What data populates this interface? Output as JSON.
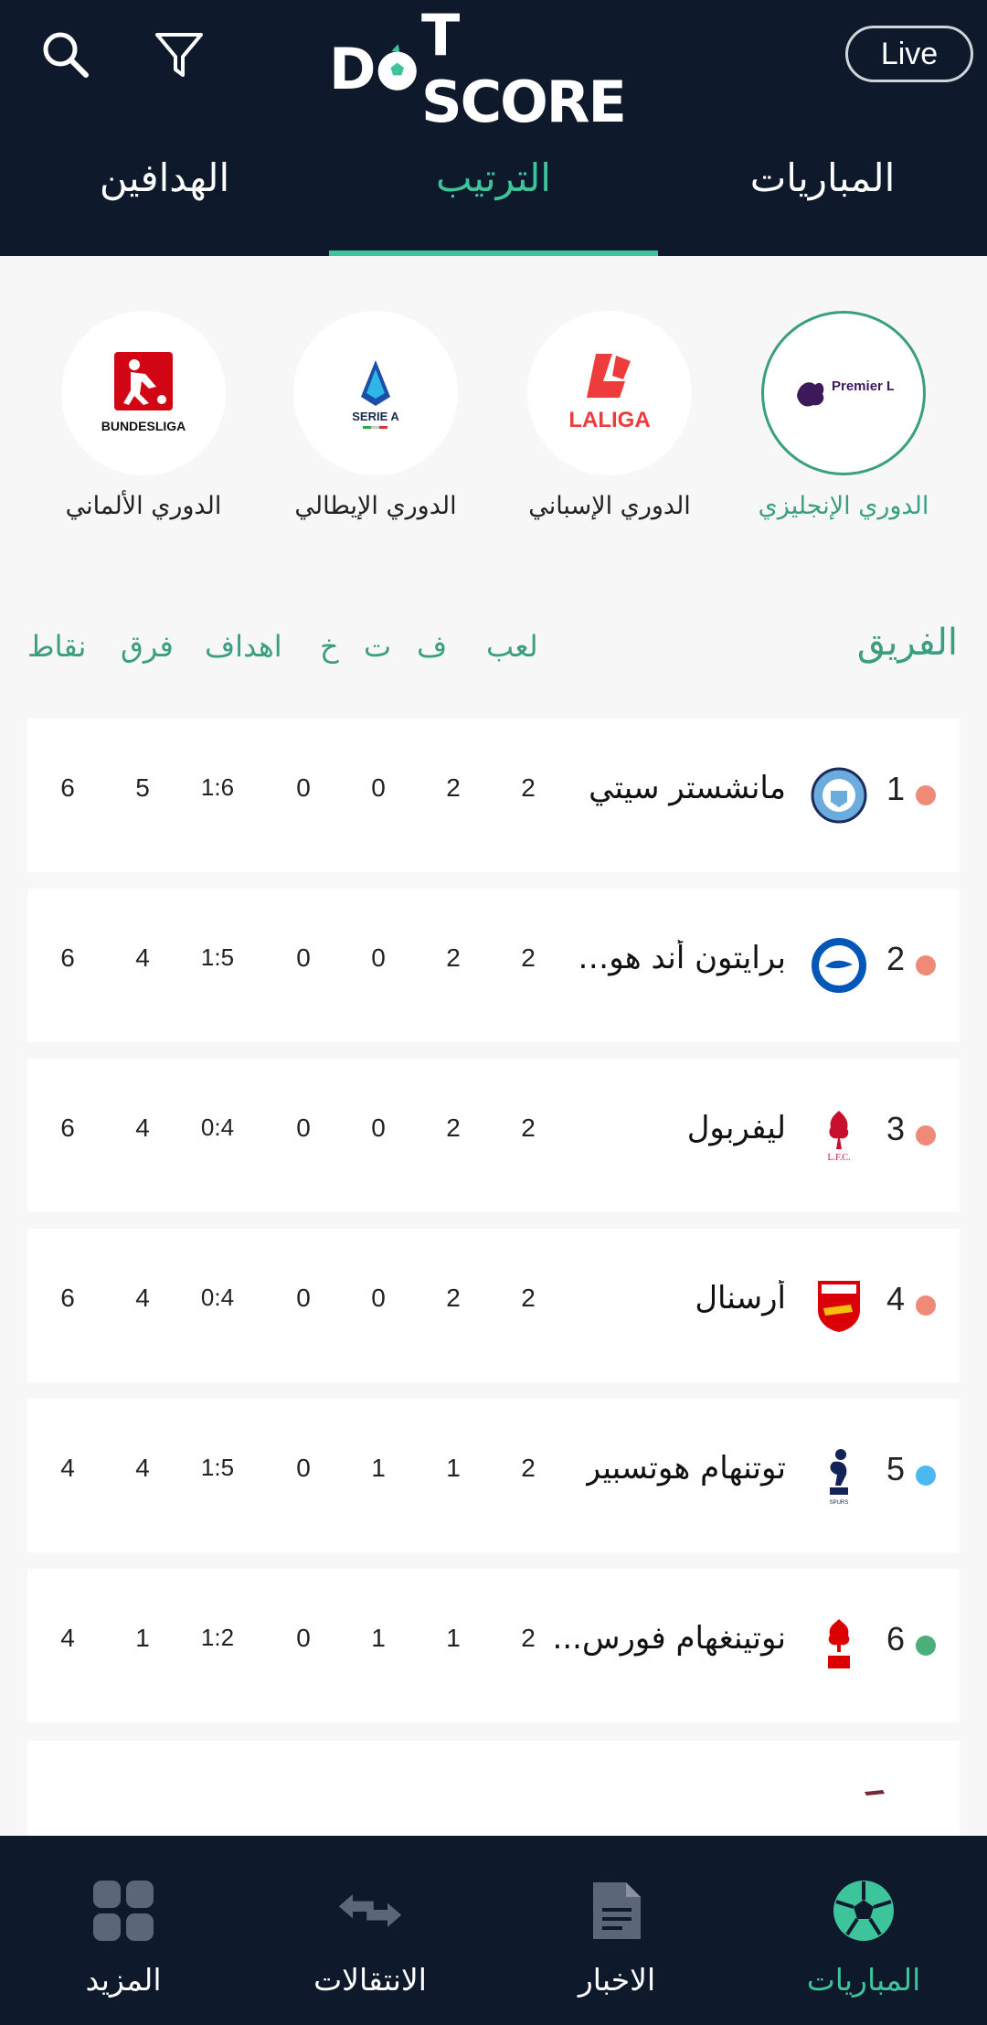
{
  "header": {
    "logo_text_left": "D",
    "logo_text_right": "T SCORE",
    "live_label": "Live"
  },
  "tabs": [
    {
      "label": "المباريات"
    },
    {
      "label": "الترتيب"
    },
    {
      "label": "الهدافين"
    }
  ],
  "leagues": [
    {
      "name": "الدوري الإنجليزي",
      "logo_text": "Premier League"
    },
    {
      "name": "الدوري الإسباني",
      "logo_text": "LALIGA"
    },
    {
      "name": "الدوري الإيطالي",
      "logo_text": "SERIE A"
    },
    {
      "name": "الدوري الألماني",
      "logo_text": "BUNDESLIGA"
    }
  ],
  "columns": {
    "team": "الفريق",
    "played": "لعب",
    "won": "ف",
    "drawn": "ت",
    "lost": "خ",
    "goals": "اهداف",
    "diff": "فرق",
    "points": "نقاط"
  },
  "standings": [
    {
      "rank": "1",
      "team": "مانشستر سيتي",
      "played": "2",
      "won": "2",
      "drawn": "0",
      "lost": "0",
      "goals": "1:6",
      "diff": "5",
      "points": "6",
      "dot_color": "#f08a78",
      "crest": "man-city-crest-icon"
    },
    {
      "rank": "2",
      "team": "برايتون أند هوف أ...",
      "played": "2",
      "won": "2",
      "drawn": "0",
      "lost": "0",
      "goals": "1:5",
      "diff": "4",
      "points": "6",
      "dot_color": "#f08a78",
      "crest": "brighton-crest-icon"
    },
    {
      "rank": "3",
      "team": "ليفربول",
      "played": "2",
      "won": "2",
      "drawn": "0",
      "lost": "0",
      "goals": "0:4",
      "diff": "4",
      "points": "6",
      "dot_color": "#f08a78",
      "crest": "liverpool-crest-icon"
    },
    {
      "rank": "4",
      "team": "أرسنال",
      "played": "2",
      "won": "2",
      "drawn": "0",
      "lost": "0",
      "goals": "0:4",
      "diff": "4",
      "points": "6",
      "dot_color": "#f08a78",
      "crest": "arsenal-crest-icon"
    },
    {
      "rank": "5",
      "team": "توتنهام هوتسبير",
      "played": "2",
      "won": "1",
      "drawn": "1",
      "lost": "0",
      "goals": "1:5",
      "diff": "4",
      "points": "4",
      "dot_color": "#4db8f0",
      "crest": "tottenham-crest-icon"
    },
    {
      "rank": "6",
      "team": "نوتينغهام فورس...",
      "played": "2",
      "won": "1",
      "drawn": "1",
      "lost": "0",
      "goals": "1:2",
      "diff": "1",
      "points": "4",
      "dot_color": "#4caf7a",
      "crest": "nottingham-crest-icon"
    }
  ],
  "bottom_nav": [
    {
      "label": "المباريات",
      "icon": "soccer-ball-icon"
    },
    {
      "label": "الاخبار",
      "icon": "news-icon"
    },
    {
      "label": "الانتقالات",
      "icon": "transfers-icon"
    },
    {
      "label": "المزيد",
      "icon": "grid-icon"
    }
  ],
  "colors": {
    "header_bg": "#0e1a2b",
    "accent": "#3dc49a",
    "accent_dark": "#3a9e7f"
  }
}
